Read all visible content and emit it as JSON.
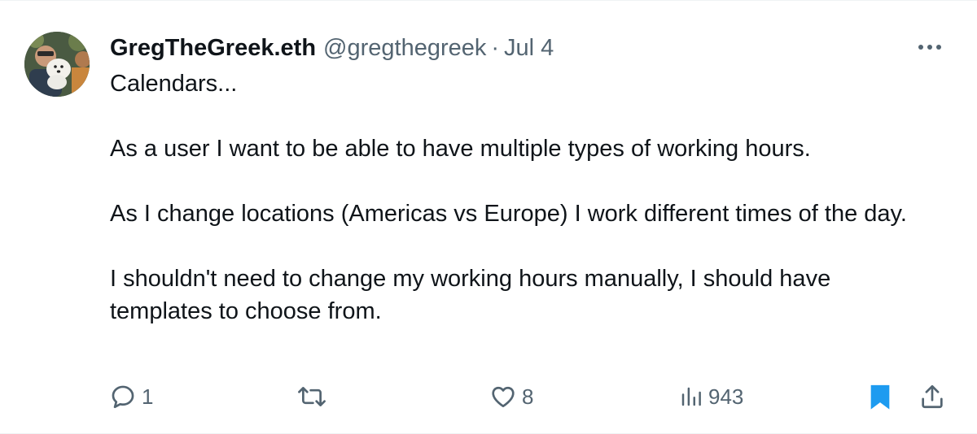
{
  "tweet": {
    "display_name": "GregTheGreek.eth",
    "handle": "@gregthegreek",
    "separator": "·",
    "time": "Jul 4",
    "paragraphs": [
      "Calendars...",
      "As a user I want to be able to have multiple types of working hours.",
      "As I change locations (Americas vs Europe) I work different times of the day.",
      "I shouldn't need to change my working hours manually, I should have templates to choose from."
    ]
  },
  "actions": {
    "reply": {
      "icon": "reply-icon",
      "count": "1"
    },
    "retweet": {
      "icon": "retweet-icon",
      "count": ""
    },
    "like": {
      "icon": "heart-icon",
      "count": "8"
    },
    "views": {
      "icon": "views-icon",
      "count": "943"
    },
    "bookmark": {
      "icon": "bookmark-icon",
      "active": true
    },
    "share": {
      "icon": "share-icon"
    }
  },
  "colors": {
    "text": "#0f1419",
    "secondary": "#536471",
    "accent": "#1d9bf0",
    "border": "#eff3f4"
  }
}
